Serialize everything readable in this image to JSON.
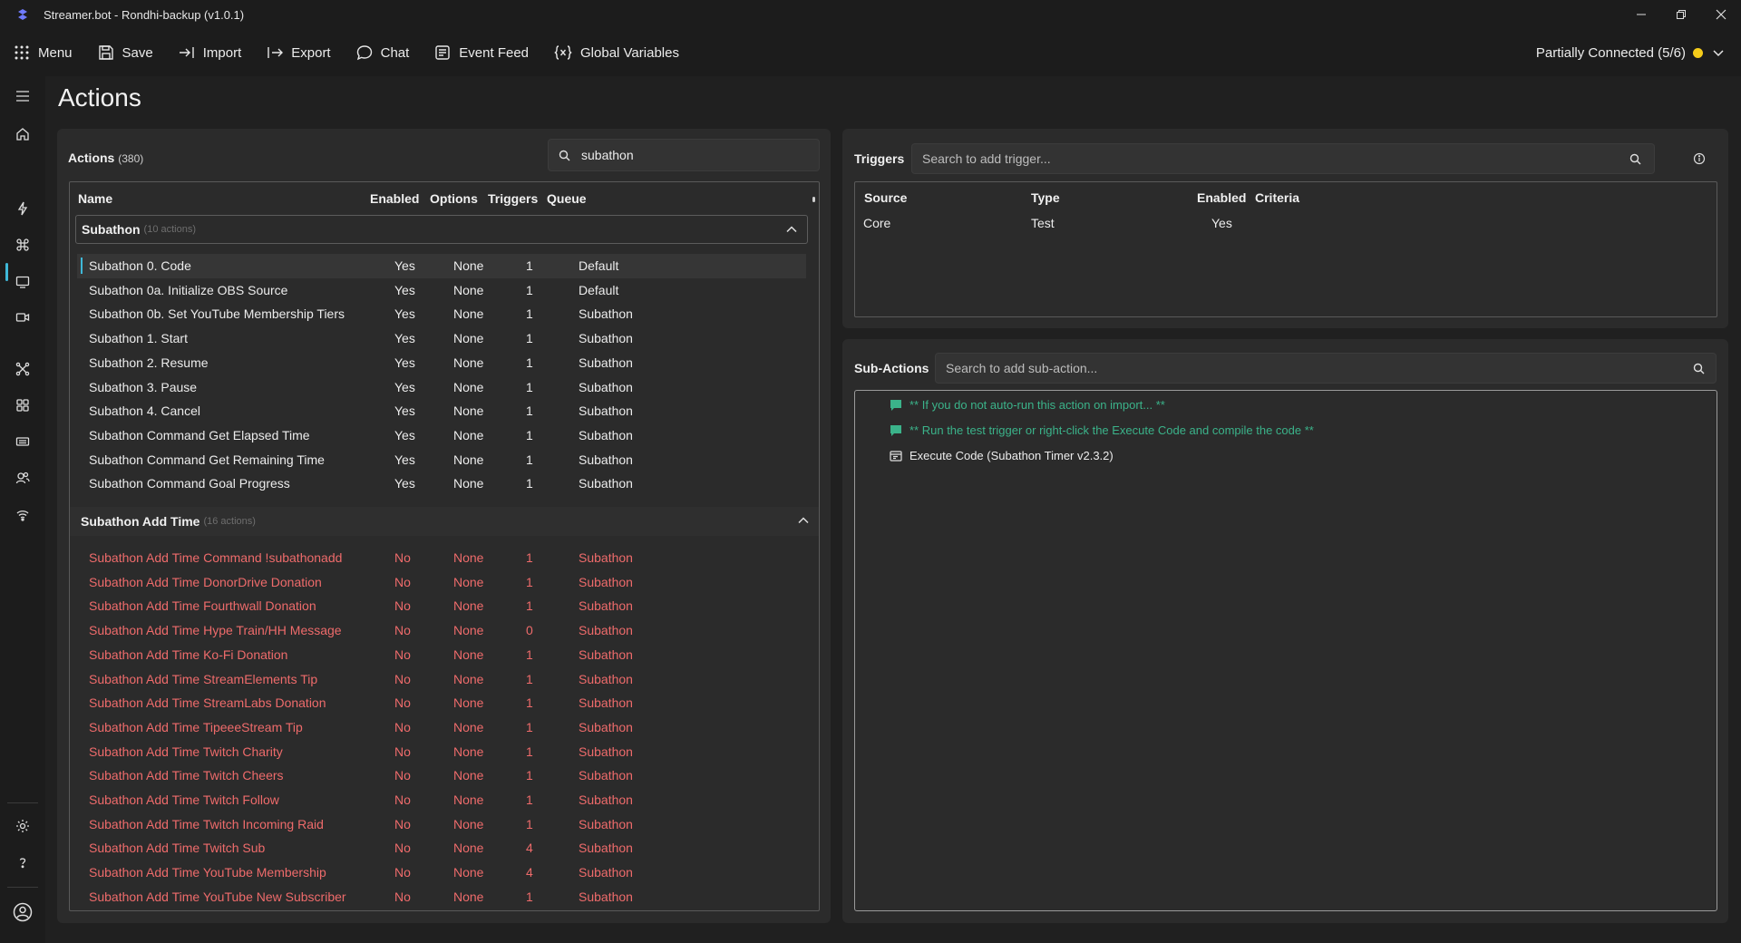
{
  "window": {
    "title": "Streamer.bot - Rondhi-backup (v1.0.1)"
  },
  "toolbar": {
    "menu": "Menu",
    "save": "Save",
    "import": "Import",
    "export": "Export",
    "chat": "Chat",
    "event_feed": "Event Feed",
    "global_variables": "Global Variables",
    "connection_status": "Partially Connected (5/6)",
    "connection_color": "#f5cc1a"
  },
  "page": {
    "title": "Actions"
  },
  "actions": {
    "label": "Actions",
    "count": "(380)",
    "search_value": "subathon",
    "columns": {
      "name": "Name",
      "enabled": "Enabled",
      "options": "Options",
      "triggers": "Triggers",
      "queue": "Queue"
    },
    "groups": [
      {
        "name": "Subathon",
        "count": "(10 actions)",
        "rows": [
          {
            "name": "Subathon 0. Code",
            "enabled": "Yes",
            "options": "None",
            "triggers": "1",
            "queue": "Default"
          },
          {
            "name": "Subathon 0a. Initialize OBS Source",
            "enabled": "Yes",
            "options": "None",
            "triggers": "1",
            "queue": "Default"
          },
          {
            "name": "Subathon 0b. Set YouTube Membership Tiers",
            "enabled": "Yes",
            "options": "None",
            "triggers": "1",
            "queue": "Subathon"
          },
          {
            "name": "Subathon 1. Start",
            "enabled": "Yes",
            "options": "None",
            "triggers": "1",
            "queue": "Subathon"
          },
          {
            "name": "Subathon 2. Resume",
            "enabled": "Yes",
            "options": "None",
            "triggers": "1",
            "queue": "Subathon"
          },
          {
            "name": "Subathon 3. Pause",
            "enabled": "Yes",
            "options": "None",
            "triggers": "1",
            "queue": "Subathon"
          },
          {
            "name": "Subathon 4. Cancel",
            "enabled": "Yes",
            "options": "None",
            "triggers": "1",
            "queue": "Subathon"
          },
          {
            "name": "Subathon Command Get Elapsed Time",
            "enabled": "Yes",
            "options": "None",
            "triggers": "1",
            "queue": "Subathon"
          },
          {
            "name": "Subathon Command Get Remaining Time",
            "enabled": "Yes",
            "options": "None",
            "triggers": "1",
            "queue": "Subathon"
          },
          {
            "name": "Subathon Command Goal Progress",
            "enabled": "Yes",
            "options": "None",
            "triggers": "1",
            "queue": "Subathon"
          }
        ]
      },
      {
        "name": "Subathon Add Time",
        "count": "(16 actions)",
        "rows": [
          {
            "name": "Subathon Add Time Command !subathonadd",
            "enabled": "No",
            "options": "None",
            "triggers": "1",
            "queue": "Subathon"
          },
          {
            "name": "Subathon Add Time DonorDrive Donation",
            "enabled": "No",
            "options": "None",
            "triggers": "1",
            "queue": "Subathon"
          },
          {
            "name": "Subathon Add Time Fourthwall Donation",
            "enabled": "No",
            "options": "None",
            "triggers": "1",
            "queue": "Subathon"
          },
          {
            "name": "Subathon Add Time Hype Train/HH Message",
            "enabled": "No",
            "options": "None",
            "triggers": "0",
            "queue": "Subathon"
          },
          {
            "name": "Subathon Add Time Ko-Fi Donation",
            "enabled": "No",
            "options": "None",
            "triggers": "1",
            "queue": "Subathon"
          },
          {
            "name": "Subathon Add Time StreamElements Tip",
            "enabled": "No",
            "options": "None",
            "triggers": "1",
            "queue": "Subathon"
          },
          {
            "name": "Subathon Add Time StreamLabs Donation",
            "enabled": "No",
            "options": "None",
            "triggers": "1",
            "queue": "Subathon"
          },
          {
            "name": "Subathon Add Time TipeeeStream Tip",
            "enabled": "No",
            "options": "None",
            "triggers": "1",
            "queue": "Subathon"
          },
          {
            "name": "Subathon Add Time Twitch Charity",
            "enabled": "No",
            "options": "None",
            "triggers": "1",
            "queue": "Subathon"
          },
          {
            "name": "Subathon Add Time Twitch Cheers",
            "enabled": "No",
            "options": "None",
            "triggers": "1",
            "queue": "Subathon"
          },
          {
            "name": "Subathon Add Time Twitch Follow",
            "enabled": "No",
            "options": "None",
            "triggers": "1",
            "queue": "Subathon"
          },
          {
            "name": "Subathon Add Time Twitch Incoming Raid",
            "enabled": "No",
            "options": "None",
            "triggers": "1",
            "queue": "Subathon"
          },
          {
            "name": "Subathon Add Time Twitch Sub",
            "enabled": "No",
            "options": "None",
            "triggers": "4",
            "queue": "Subathon"
          },
          {
            "name": "Subathon Add Time YouTube Membership",
            "enabled": "No",
            "options": "None",
            "triggers": "4",
            "queue": "Subathon"
          },
          {
            "name": "Subathon Add Time YouTube New Subscriber",
            "enabled": "No",
            "options": "None",
            "triggers": "1",
            "queue": "Subathon"
          }
        ]
      }
    ]
  },
  "triggers": {
    "label": "Triggers",
    "search_placeholder": "Search to add trigger...",
    "columns": {
      "source": "Source",
      "type": "Type",
      "enabled": "Enabled",
      "criteria": "Criteria"
    },
    "rows": [
      {
        "source": "Core",
        "type": "Test",
        "enabled": "Yes",
        "criteria": ""
      }
    ]
  },
  "sub_actions": {
    "label": "Sub-Actions",
    "search_placeholder": "Search to add sub-action...",
    "items": [
      {
        "kind": "comment",
        "text": "** If you do not auto-run this action on import... **"
      },
      {
        "kind": "comment",
        "text": "** Run the test trigger or right-click the Execute Code and compile the code **"
      },
      {
        "kind": "code",
        "text": "Execute Code (Subathon Timer v2.3.2)"
      }
    ]
  },
  "colors": {
    "accent": "#3fb8d8",
    "disabled_text": "#ee6b6b",
    "comment_text": "#3bb38a"
  }
}
